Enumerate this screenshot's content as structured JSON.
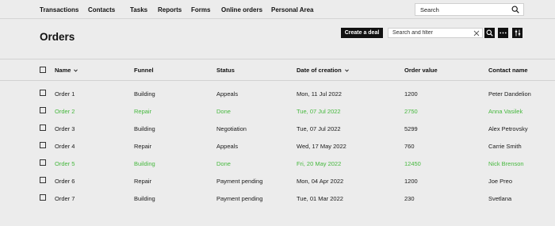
{
  "nav": {
    "items": [
      "Transactions",
      "Contacts",
      "Tasks",
      "Reports",
      "Forms",
      "Online orders",
      "Personal Area"
    ],
    "search_placeholder": "Search"
  },
  "page": {
    "title": "Orders",
    "create_label": "Create a deal",
    "filter_placeholder": "Search and filter"
  },
  "table": {
    "columns": [
      "Name",
      "Funnel",
      "Status",
      "Date of creation",
      "Order value",
      "Contact name"
    ],
    "sortable_columns": [
      "Name",
      "Date of creation"
    ],
    "highlight_color": "#46b83e",
    "rows": [
      {
        "name": "Order 1",
        "funnel": "Building",
        "status": "Appeals",
        "date": "Mon, 11 Jul 2022",
        "value": "1200",
        "contact": "Peter Dandelion",
        "highlighted": false
      },
      {
        "name": "Order 2",
        "funnel": "Repair",
        "status": "Done",
        "date": "Tue, 07 Jul 2022",
        "value": "2750",
        "contact": "Anna Vasilek",
        "highlighted": true
      },
      {
        "name": "Order 3",
        "funnel": "Building",
        "status": "Negotiation",
        "date": "Tue, 07 Jul 2022",
        "value": "5299",
        "contact": "Alex Petrovsky",
        "highlighted": false
      },
      {
        "name": "Order 4",
        "funnel": "Repair",
        "status": "Appeals",
        "date": "Wed, 17 May 2022",
        "value": "760",
        "contact": "Carrie Smith",
        "highlighted": false
      },
      {
        "name": "Order 5",
        "funnel": "Building",
        "status": "Done",
        "date": "Fri, 20 May 2022",
        "value": "12450",
        "contact": "Nick Brenson",
        "highlighted": true
      },
      {
        "name": "Order 6",
        "funnel": "Repair",
        "status": "Payment pending",
        "date": "Mon, 04 Apr 2022",
        "value": "1200",
        "contact": "Joe Preo",
        "highlighted": false
      },
      {
        "name": "Order 7",
        "funnel": "Building",
        "status": "Payment pending",
        "date": "Tue, 01 Mar 2022",
        "value": "230",
        "contact": "Svetlana",
        "highlighted": false
      }
    ]
  }
}
